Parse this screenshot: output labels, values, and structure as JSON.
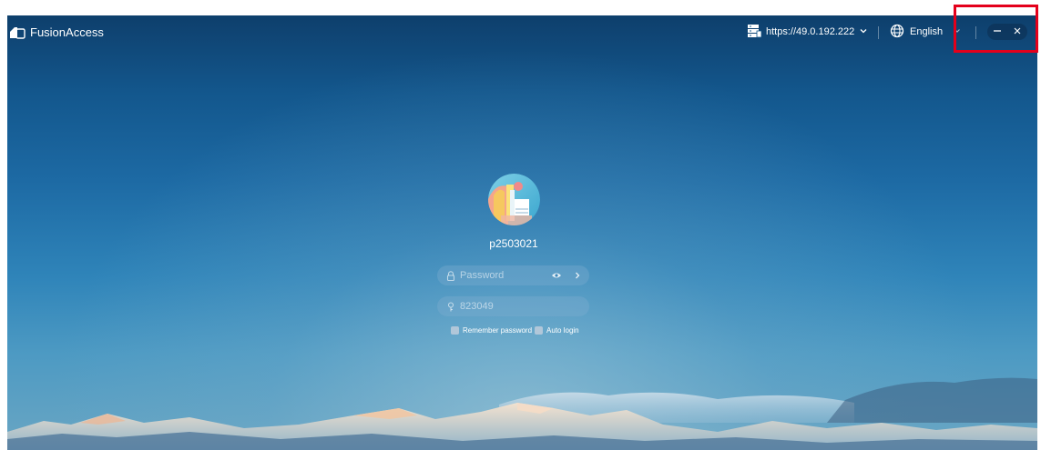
{
  "app": {
    "title": "FusionAccess",
    "icon": "fusionaccess-logo-icon"
  },
  "titlebar": {
    "server_url": "https://49.0.192.222",
    "server_icon": "server-icon",
    "language": "English",
    "language_icon": "globe-icon",
    "minimize_icon": "minimize-icon",
    "close_icon": "close-icon"
  },
  "login": {
    "username": "p2503021",
    "password_placeholder": "Password",
    "code_placeholder": "823049",
    "remember_password_label": "Remember password",
    "auto_login_label": "Auto login"
  },
  "colors": {
    "highlight": "#e4001b",
    "text": "#ffffff"
  }
}
